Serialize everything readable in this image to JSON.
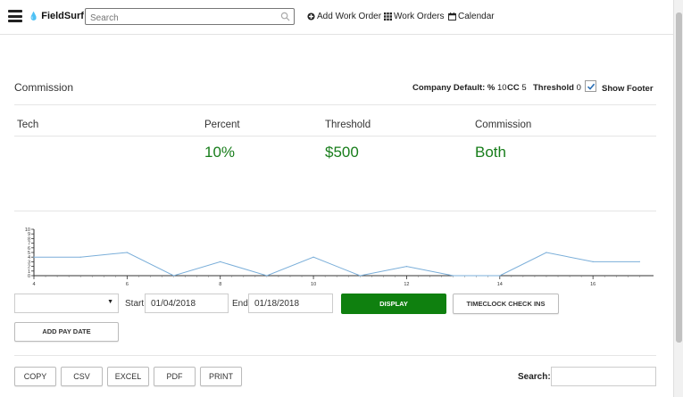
{
  "nav": {
    "brand": "FieldSurf",
    "search_placeholder": "Search",
    "add_work_order": "Add Work Order",
    "work_orders": "Work Orders",
    "calendar": "Calendar"
  },
  "commission": {
    "title": "Commission",
    "company_default_label": "Company Default: %",
    "company_default_value": "10",
    "cc_label": "CC",
    "cc_value": "5",
    "threshold_label": "Threshold",
    "threshold_value": "0",
    "show_footer_label": "Show Footer",
    "show_footer_checked": true
  },
  "table": {
    "headers": [
      "Tech",
      "Percent",
      "Threshold",
      "Commission"
    ],
    "row": [
      "",
      "10%",
      "$500",
      "Both"
    ]
  },
  "chart_data": {
    "type": "line",
    "x": [
      4,
      5,
      6,
      7,
      8,
      9,
      10,
      11,
      12,
      13,
      14,
      15,
      16,
      17
    ],
    "values": [
      4,
      4,
      5,
      0,
      3,
      0,
      4,
      0,
      2,
      0,
      0,
      5,
      3,
      3
    ],
    "y_ticks": [
      "10",
      "9",
      "8",
      "7",
      "6",
      "5",
      "4",
      "3",
      "2",
      "1",
      "0"
    ],
    "x_tick_labels": [
      "4",
      "6",
      "8",
      "10",
      "12",
      "14",
      "16"
    ],
    "x_tick_values": [
      4,
      6,
      8,
      10,
      12,
      14,
      16
    ],
    "ylim": [
      0,
      10
    ],
    "xlim": [
      4,
      17.3
    ],
    "line_color": "#7aaed9"
  },
  "controls": {
    "start_label": "Start",
    "start_date": "01/04/2018",
    "end_label": "End",
    "end_date": "01/18/2018",
    "display_button": "DISPLAY",
    "timeclock_button": "TIMECLOCK CHECK INS",
    "add_pay_date_button": "ADD PAY DATE"
  },
  "export": {
    "buttons": [
      "COPY",
      "CSV",
      "EXCEL",
      "PDF",
      "PRINT"
    ],
    "search_label": "Search:"
  },
  "colors": {
    "accent_green": "#0f800f",
    "value_green": "#177d1a"
  }
}
